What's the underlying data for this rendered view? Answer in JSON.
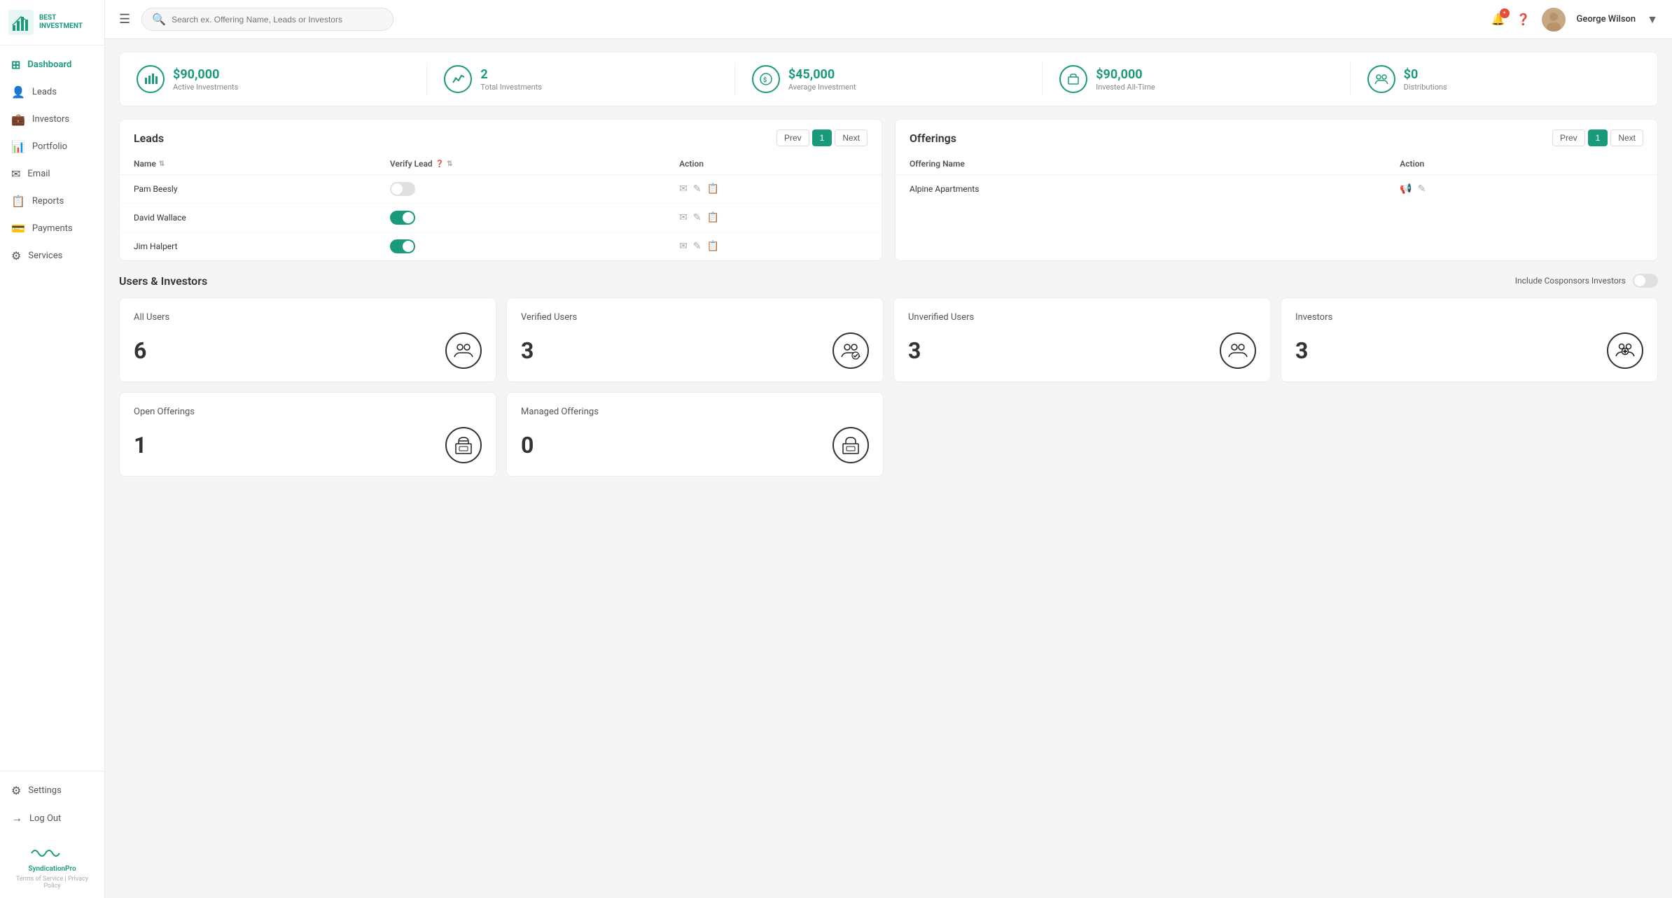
{
  "app": {
    "name": "BEST INVESTMENT",
    "subtitle": "BEST INVESTMENT"
  },
  "topbar": {
    "search_placeholder": "Search ex. Offering Name, Leads or Investors",
    "user_name": "George Wilson",
    "notification_count": "*"
  },
  "sidebar": {
    "items": [
      {
        "id": "dashboard",
        "label": "Dashboard",
        "icon": "⊞",
        "active": true
      },
      {
        "id": "leads",
        "label": "Leads",
        "icon": "👤"
      },
      {
        "id": "investors",
        "label": "Investors",
        "icon": "💼"
      },
      {
        "id": "portfolio",
        "label": "Portfolio",
        "icon": "📊"
      },
      {
        "id": "email",
        "label": "Email",
        "icon": "✉"
      },
      {
        "id": "reports",
        "label": "Reports",
        "icon": "📋"
      },
      {
        "id": "payments",
        "label": "Payments",
        "icon": "💳"
      },
      {
        "id": "services",
        "label": "Services",
        "icon": "⚙"
      }
    ],
    "bottom_items": [
      {
        "id": "settings",
        "label": "Settings",
        "icon": "⚙"
      },
      {
        "id": "logout",
        "label": "Log Out",
        "icon": "→"
      }
    ],
    "footer": {
      "brand": "SyndicationPro",
      "links": [
        "Terms of Service",
        "Privacy Policy"
      ]
    }
  },
  "stats": [
    {
      "id": "active-investments",
      "value": "$90,000",
      "label": "Active Investments",
      "icon": "🏦"
    },
    {
      "id": "total-investments",
      "value": "2",
      "label": "Total Investments",
      "icon": "📈"
    },
    {
      "id": "average-investment",
      "value": "$45,000",
      "label": "Average Investment",
      "icon": "💰"
    },
    {
      "id": "invested-all-time",
      "value": "$90,000",
      "label": "Invested All-Time",
      "icon": "📦"
    },
    {
      "id": "distributions",
      "value": "$0",
      "label": "Distributions",
      "icon": "👥"
    }
  ],
  "leads": {
    "title": "Leads",
    "pagination": {
      "prev": "Prev",
      "current": "1",
      "next": "Next"
    },
    "columns": {
      "name": "Name",
      "verify_lead": "Verify Lead",
      "action": "Action"
    },
    "rows": [
      {
        "name": "Pam Beesly",
        "verified": false
      },
      {
        "name": "David Wallace",
        "verified": true
      },
      {
        "name": "Jim Halpert",
        "verified": true
      }
    ]
  },
  "offerings": {
    "title": "Offerings",
    "pagination": {
      "prev": "Prev",
      "current": "1",
      "next": "Next"
    },
    "columns": {
      "offering_name": "Offering Name",
      "action": "Action"
    },
    "rows": [
      {
        "name": "Alpine Apartments"
      }
    ]
  },
  "users_investors": {
    "title": "Users & Investors",
    "cosponsors_label": "Include Cosponsors Investors",
    "cards": [
      {
        "id": "all-users",
        "title": "All Users",
        "value": "6",
        "icon": "👥"
      },
      {
        "id": "verified-users",
        "title": "Verified Users",
        "value": "3",
        "icon": "👥"
      },
      {
        "id": "unverified-users",
        "title": "Unverified Users",
        "value": "3",
        "icon": "👥"
      },
      {
        "id": "investors",
        "title": "Investors",
        "value": "3",
        "icon": "👥"
      }
    ],
    "offerings_cards": [
      {
        "id": "open-offerings",
        "title": "Open Offerings",
        "value": "1",
        "icon": "🏠"
      },
      {
        "id": "managed-offerings",
        "title": "Managed Offerings",
        "value": "0",
        "icon": "🏠"
      }
    ]
  }
}
